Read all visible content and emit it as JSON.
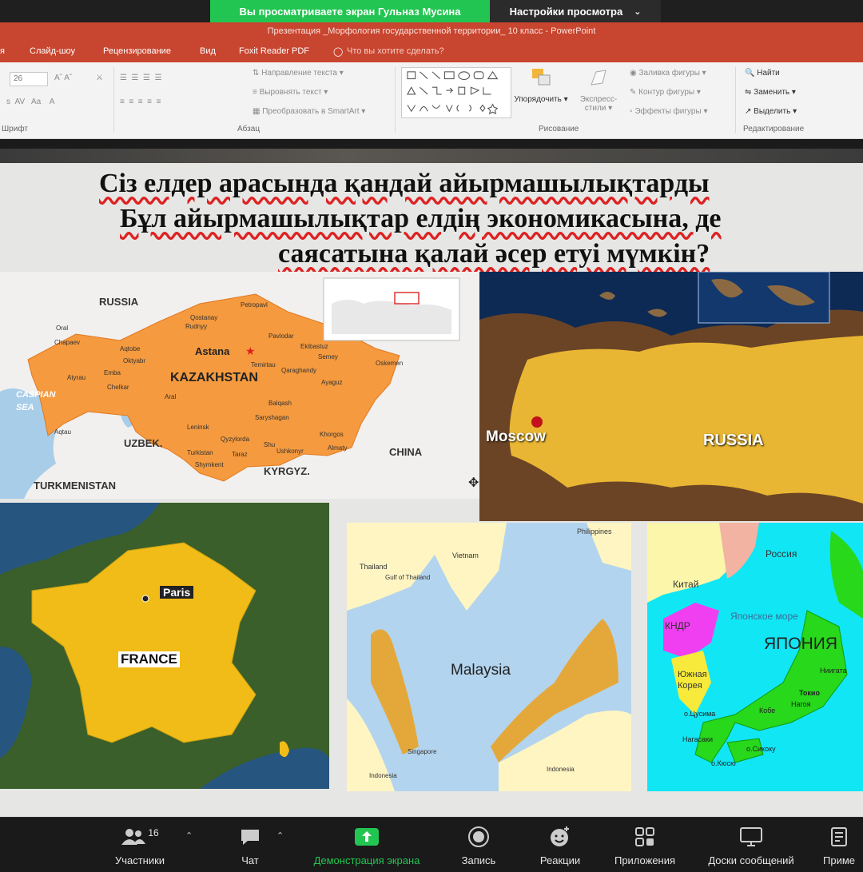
{
  "zoom": {
    "banner": "Вы просматриваете экран Гульназ Мусина",
    "view_options": "Настройки просмотра",
    "toolbar": {
      "participants_count": "16",
      "participants": "Участники",
      "chat": "Чат",
      "share": "Демонстрация экрана",
      "record": "Запись",
      "reactions": "Реакции",
      "apps": "Приложения",
      "whiteboards": "Доски сообщений",
      "notes": "Приме"
    }
  },
  "powerpoint": {
    "title": "Презентация _Морфология государственной территории_ 10 класс - PowerPoint",
    "tabs": [
      "я",
      "Слайд-шоу",
      "Рецензирование",
      "Вид",
      "Foxit Reader PDF"
    ],
    "tell_me": "Что вы хотите сделать?",
    "ribbon": {
      "font_size": "26",
      "groups": {
        "font": "Шрифт",
        "paragraph": "Абзац",
        "drawing": "Рисование",
        "editing": "Редактирование"
      },
      "text_direction": "Направление текста",
      "align_text": "Выровнять текст",
      "convert_smartart": "Преобразовать в SmartArt",
      "arrange": "Упорядочить",
      "quick_styles_1": "Экспресс-",
      "quick_styles_2": "стили",
      "shape_fill": "Заливка фигуры",
      "shape_outline": "Контур фигуры",
      "shape_effects": "Эффекты фигуры",
      "find": "Найти",
      "replace": "Заменить",
      "select": "Выделить"
    }
  },
  "slide": {
    "title_lines": [
      "Сіз елдер арасында қандай айырмашылықтарды",
      "Бұл айырмашылықтар елдің экономикасына, де",
      "саясатына қалай әсер етуі мүмкін?"
    ],
    "kazakhstan_map": {
      "country": "KAZAKHSTAN",
      "capital": "Astana",
      "neighbors": {
        "russia": "RUSSIA",
        "china": "CHINA",
        "uzbek": "UZBEK.",
        "kyrgyz": "KYRGYZ.",
        "turkmenistan": "TURKMENISTAN"
      },
      "sea_1": "CASPIAN",
      "sea_2": "SEA",
      "cities": [
        "Petropavl",
        "Qostanay",
        "Rudnyy",
        "Oral",
        "Chapaev",
        "Aqtobe",
        "Oktyabr",
        "Emba",
        "Atyrau",
        "Chelkar",
        "Aral",
        "Pavlodar",
        "Ekibastuz",
        "Semey",
        "Temirtau",
        "Qaraghandy",
        "Oskemen",
        "Ayaguz",
        "Balqash",
        "Saryshagan",
        "Leninsk",
        "Qyzylorda",
        "Turkistan",
        "Shymkent",
        "Taraz",
        "Shu",
        "Ushkonyr",
        "Almaty",
        "Khorgos",
        "Aqtau"
      ]
    },
    "russia_map": {
      "country": "RUSSIA",
      "capital": "Moscow"
    },
    "france_map": {
      "country": "FRANCE",
      "capital": "Paris"
    },
    "malaysia_map": {
      "country": "Malaysia",
      "labels": [
        "Philippines",
        "Vietnam",
        "Thailand",
        "Gulf of Thailand",
        "Singapore",
        "Indonesia",
        "Indonesia"
      ]
    },
    "japan_map": {
      "country": "ЯПОНИЯ",
      "labels": [
        "Россия",
        "Китай",
        "КНДР",
        "Японское море",
        "Южная",
        "Корея",
        "Токио",
        "Нагоя",
        "Ниигата",
        "Кобе",
        "Нагасаки",
        "о.Сикоку",
        "о.Кюсю",
        "о.Цусима"
      ]
    }
  }
}
